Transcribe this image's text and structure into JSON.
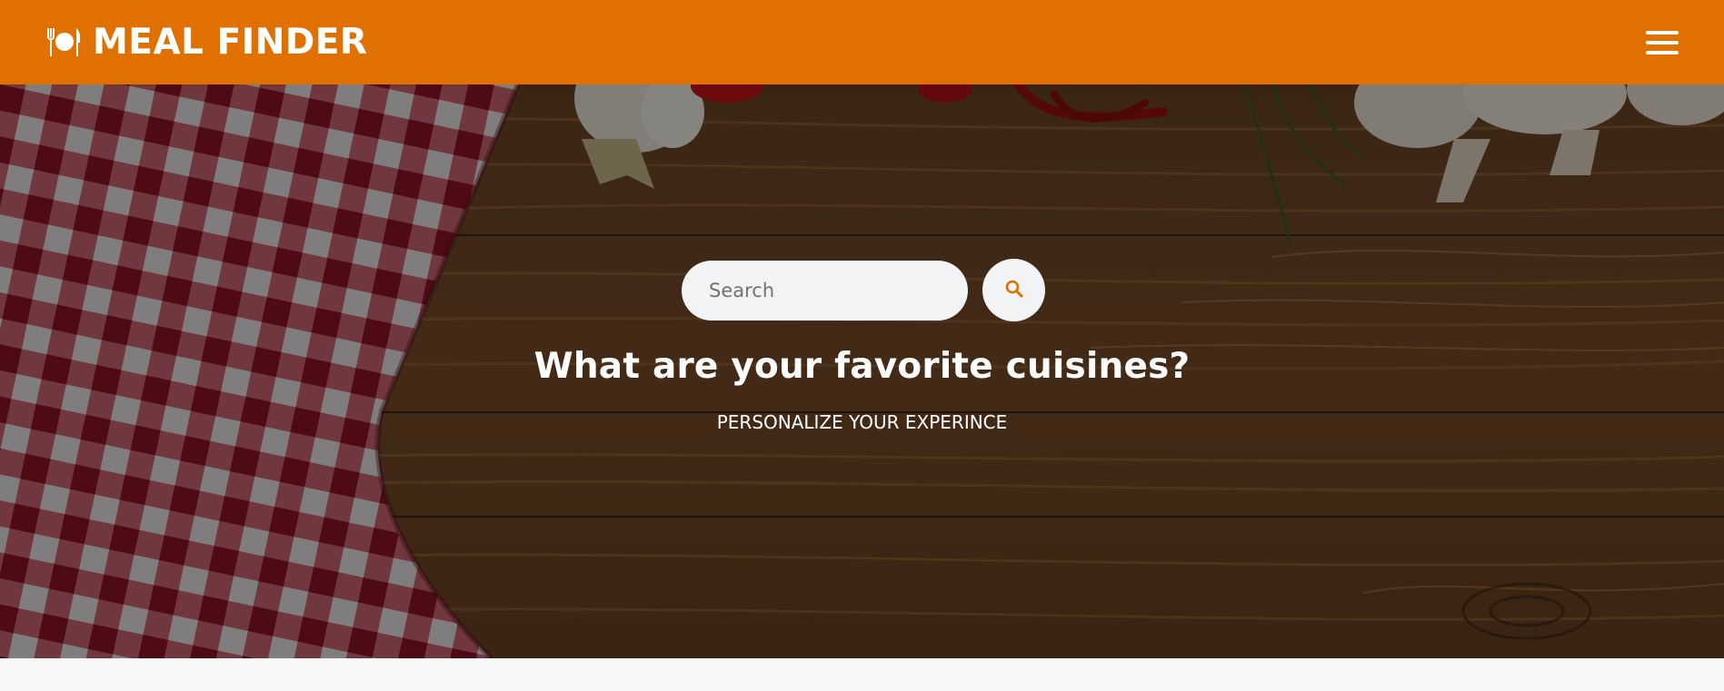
{
  "colors": {
    "header_bg": "#e07000",
    "accent": "#e07000",
    "hero_overlay": "rgba(0,0,0,0.45)",
    "page_bg": "#f8f8f8"
  },
  "header": {
    "brand_icon": "plate-fork-knife-icon",
    "brand_title": "MEAL FINDER",
    "menu_icon": "hamburger-menu-icon"
  },
  "hero": {
    "background": "wooden table with red checkered cloth, garlic, chili peppers, rosemary and mushrooms",
    "search": {
      "placeholder": "Search",
      "value": "",
      "button_icon": "search-icon"
    },
    "title": "What are your favorite cuisines?",
    "subtitle": "PERSONALIZE YOUR EXPERINCE"
  }
}
